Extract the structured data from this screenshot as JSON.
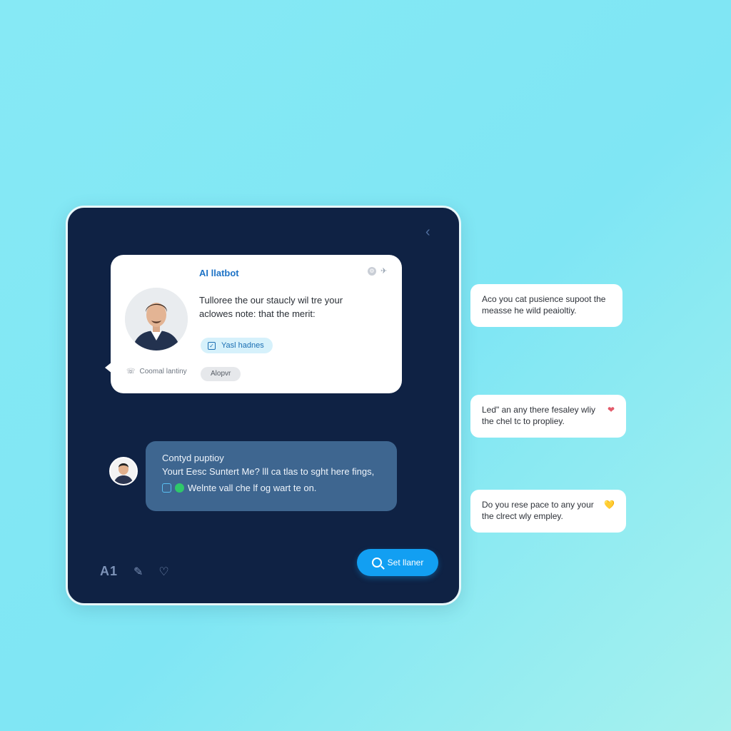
{
  "chat": {
    "card": {
      "title": "AI llatbot",
      "text_line1": "Tulloree the our staucly wil tre your",
      "text_line2": "aclowes note: that the merit:",
      "primary_action": "Yasl hadnes",
      "footer_label": "Coomal lantiny",
      "secondary_action": "Alopvr"
    },
    "reply": {
      "title": "Contyd puptioy",
      "line1": "Yourt Eesc Suntert Me? lll ca tlas to sght here fings,",
      "line2": "Welnte vall che lf og wart te on."
    },
    "toolbar": {
      "ai_label": "A1"
    },
    "search_button": "Set llaner"
  },
  "side_messages": [
    {
      "line1": "Aco you cat pusience supoot the",
      "line2": "measse he wild peaioltiy.",
      "emoji": ""
    },
    {
      "line1": "Led\" an any there fesaley wliy",
      "line2": "the chel tc to propliey.",
      "emoji": "❤"
    },
    {
      "line1": "Do you rese pace to any your",
      "line2": "the clrect wly empley.",
      "emoji": "💛"
    }
  ],
  "colors": {
    "panel": "#0f2244",
    "accent": "#129ff2",
    "bubble": "#3e6690"
  }
}
